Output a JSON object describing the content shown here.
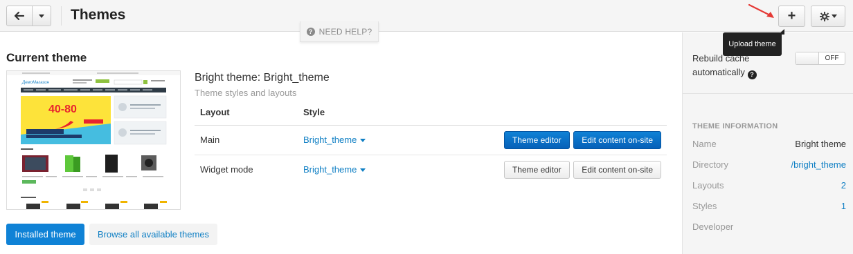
{
  "header": {
    "title": "Themes",
    "help_label": "NEED HELP?",
    "plus_label": "+",
    "tooltip": "Upload theme"
  },
  "current": {
    "section_title": "Current theme",
    "theme_name": "Bright theme: Bright_theme",
    "theme_sub": "Theme styles and layouts",
    "table_headers": {
      "layout": "Layout",
      "style": "Style"
    },
    "rows": [
      {
        "layout": "Main",
        "style": "Bright_theme",
        "editor": "Theme editor",
        "onsite": "Edit content on-site"
      },
      {
        "layout": "Widget mode",
        "style": "Bright_theme",
        "editor": "Theme editor",
        "onsite": "Edit content on-site"
      }
    ]
  },
  "thumbnail": {
    "logo": "ДемоМагазин",
    "promo": "40-80",
    "promo_caption": "СКИДКИ НА САМЫЕ ГОРЯЧИЕ ТОВАРЫ",
    "section_new": "Новинки",
    "section_best": "Лучшие цены"
  },
  "tabs": {
    "installed": "Installed theme",
    "browse": "Browse all available themes"
  },
  "sidebar": {
    "rebuild_label": "Rebuild cache automatically",
    "toggle_state": "OFF",
    "info_title": "THEME INFORMATION",
    "info": [
      {
        "key": "Name",
        "value": "Bright theme",
        "link": false
      },
      {
        "key": "Directory",
        "value": "/bright_theme",
        "link": true
      },
      {
        "key": "Layouts",
        "value": "2",
        "link": true
      },
      {
        "key": "Styles",
        "value": "1",
        "link": true
      },
      {
        "key": "Developer",
        "value": "",
        "link": false
      }
    ]
  },
  "colors": {
    "primary": "#0f82d6",
    "link": "#0f7fc4",
    "tooltip_bg": "#222222",
    "arrow": "#e53935"
  },
  "icons": {
    "back": "arrow-left-icon",
    "caret": "caret-down-icon",
    "gear": "gear-icon",
    "help": "question-circle-icon"
  }
}
